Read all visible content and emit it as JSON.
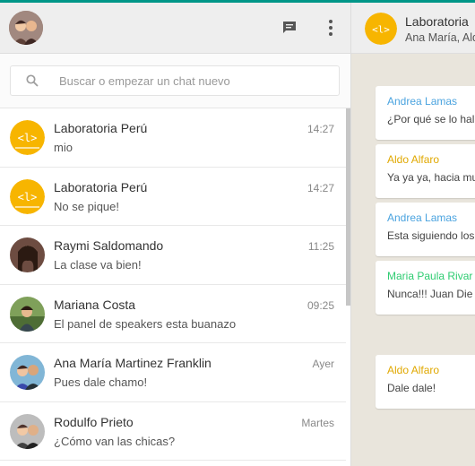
{
  "colors": {
    "accent": "#009688",
    "author_blue": "#4aa3df",
    "author_gold": "#e0a800",
    "author_green": "#2ecc71",
    "laboratoria_yellow": "#f7b500"
  },
  "header": {
    "chat_icon": "chat-icon",
    "menu_icon": "more-vert-icon"
  },
  "search": {
    "placeholder": "Buscar o empezar un chat nuevo"
  },
  "chats": [
    {
      "name": "Laboratoria Perú",
      "time": "14:27",
      "last": "mio"
    },
    {
      "name": "Laboratoria Perú",
      "time": "14:27",
      "last": "No se pique!"
    },
    {
      "name": "Raymi Saldomando",
      "time": "11:25",
      "last": "La clase va bien!"
    },
    {
      "name": "Mariana Costa",
      "time": "09:25",
      "last": "El panel de speakers esta buanazo"
    },
    {
      "name": "Ana María Martinez Franklin",
      "time": "Ayer",
      "last": "Pues dale chamo!"
    },
    {
      "name": "Rodulfo Prieto",
      "time": "Martes",
      "last": "¿Cómo van las chicas?"
    }
  ],
  "conversation": {
    "title": "Laboratoria",
    "subtitle": "Ana María, Aldo",
    "messages": [
      {
        "author": "Andrea Lamas",
        "text": "¿Por qué se lo hal"
      },
      {
        "author": "Aldo Alfaro",
        "text": "Ya ya ya, hacia mu"
      },
      {
        "author": "Andrea Lamas",
        "text": "Esta siguiendo los"
      },
      {
        "author": "Maria Paula Rivar",
        "text": "Nunca!!! Juan Die"
      },
      {
        "author": "Aldo Alfaro",
        "text": "Dale dale!"
      }
    ]
  }
}
